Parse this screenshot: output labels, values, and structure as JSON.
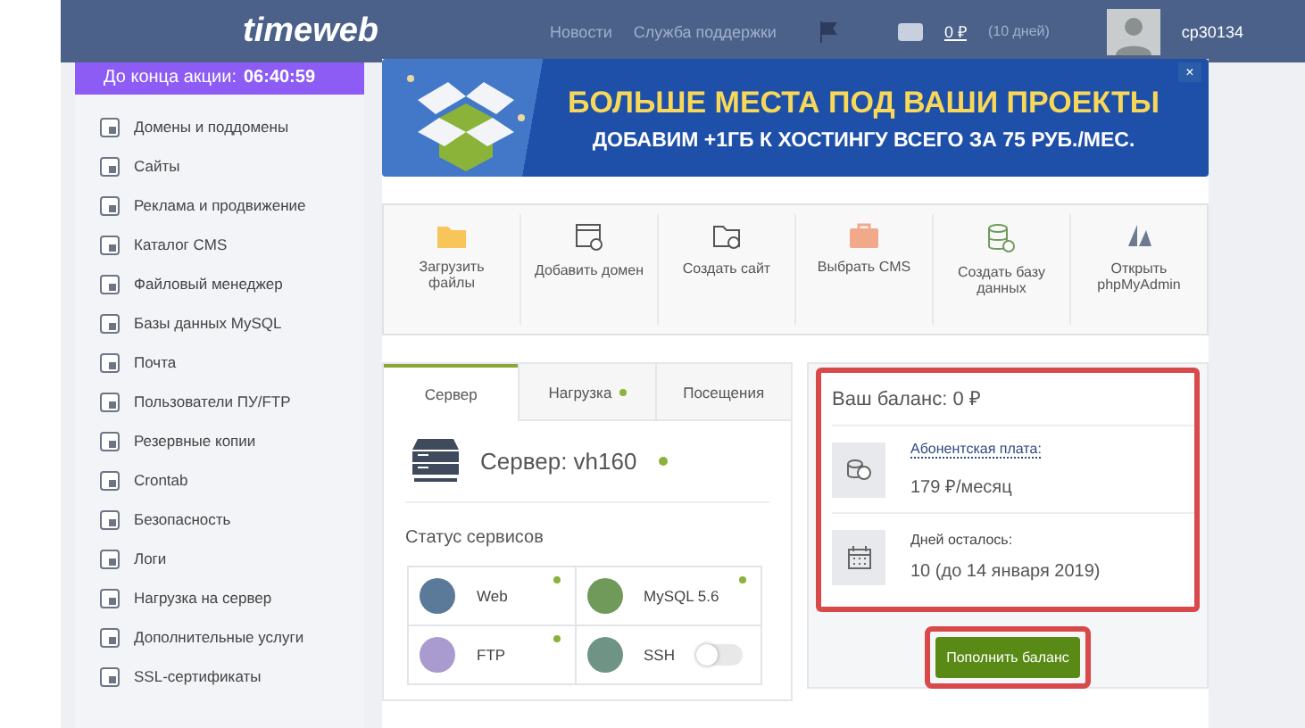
{
  "header": {
    "logo": "timeweb",
    "links": [
      "Новости",
      "Служба поддержки"
    ],
    "balance": "0 ₽",
    "balance_note": "(10 дней)",
    "user": "cp30134"
  },
  "promo": {
    "label": "До конца акции:",
    "timer": "06:40:59"
  },
  "sidebar": {
    "items": [
      "Домены и поддомены",
      "Сайты",
      "Реклама и продвижение",
      "Каталог CMS",
      "Файловый менеджер",
      "Базы данных MySQL",
      "Почта",
      "Пользователи ПУ/FTP",
      "Резервные копии",
      "Crontab",
      "Безопасность",
      "Логи",
      "Нагрузка на сервер",
      "Дополнительные услуги",
      "SSL-сертификаты"
    ]
  },
  "banner": {
    "title": "БОЛЬШЕ МЕСТА ПОД ВАШИ ПРОЕКТЫ",
    "subtitle": "ДОБАВИМ +1ГБ К ХОСТИНГУ ВСЕГО ЗА 75 РУБ./МЕС.",
    "close": "×"
  },
  "actions": [
    {
      "kind": "folder",
      "label": "Загрузить файлы"
    },
    {
      "kind": "window",
      "label": "Добавить домен"
    },
    {
      "kind": "folder-plus",
      "label": "Создать сайт"
    },
    {
      "kind": "briefcase",
      "label": "Выбрать CMS"
    },
    {
      "kind": "database",
      "label": "Создать базу данных"
    },
    {
      "kind": "sail",
      "label": "Открыть phpMyAdmin"
    }
  ],
  "tabs": [
    {
      "label": "Сервер",
      "selected": true,
      "indicator": false
    },
    {
      "label": "Нагрузка",
      "selected": false,
      "indicator": true
    },
    {
      "label": "Посещения",
      "selected": false,
      "indicator": false
    }
  ],
  "server": {
    "name": "Сервер: vh160",
    "online": true,
    "services_title": "Статус сервисов",
    "services": [
      {
        "name": "Web",
        "kind": "status",
        "on": true,
        "color": "#5b7a99"
      },
      {
        "name": "MySQL 5.6",
        "kind": "status",
        "on": true,
        "color": "#6f9a5a"
      },
      {
        "name": "FTP",
        "kind": "status",
        "on": true,
        "color": "#a99ad0"
      },
      {
        "name": "SSH",
        "kind": "toggle",
        "on": false,
        "color": "#6f9486"
      }
    ]
  },
  "balance": {
    "title": "Ваш баланс: 0 ₽",
    "items": [
      {
        "kind": "coins",
        "label": "Абонентская плата:",
        "value": "179 ₽/месяц"
      },
      {
        "kind": "calendar",
        "label": "Дней осталось:",
        "value": "10 (до 14 января 2019)"
      }
    ],
    "button": "Пополнить баланс"
  }
}
